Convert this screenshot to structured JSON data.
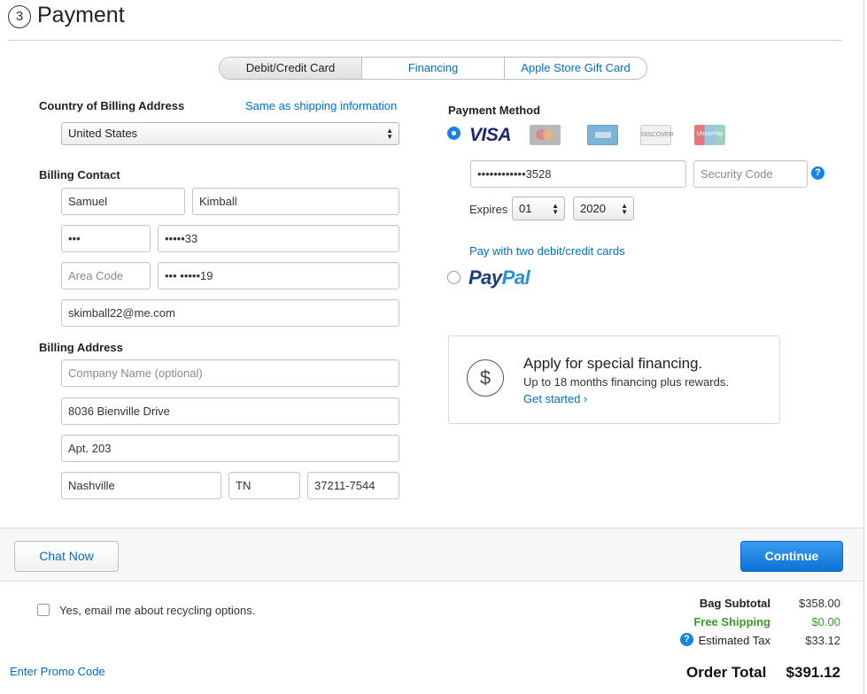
{
  "header": {
    "step_number": "3",
    "title": "Payment"
  },
  "tabs": [
    {
      "label": "Debit/Credit Card",
      "selected": true
    },
    {
      "label": "Financing",
      "selected": false
    },
    {
      "label": "Apple Store Gift Card",
      "selected": false
    }
  ],
  "billing": {
    "country_label": "Country of Billing Address",
    "same_as_shipping_link": "Same as shipping information",
    "country_value": "United States",
    "contact_label": "Billing Contact",
    "first_name": "Samuel",
    "last_name": "Kimball",
    "phone_prefix": "•••",
    "phone_masked": "•••••33",
    "area_code_placeholder": "Area Code",
    "phone2_masked": "••• •••••19",
    "email": "skimball22@me.com",
    "address_label": "Billing Address",
    "company_placeholder": "Company Name (optional)",
    "street": "8036 Bienville Drive",
    "apt": "Apt. 203",
    "city": "Nashville",
    "state": "TN",
    "zip": "37211-7544"
  },
  "payment": {
    "method_label": "Payment Method",
    "visa_text": "VISA",
    "discover_text": "DISCOVER",
    "unionpay_text": "UnionPay",
    "card_number_masked": "••••••••••••3528",
    "security_code_placeholder": "Security Code",
    "help_glyph": "?",
    "expires_label": "Expires",
    "exp_month": "01",
    "exp_year": "2020",
    "two_cards_link": "Pay with two debit/credit cards",
    "paypal_part1": "Pay",
    "paypal_part2": "Pal",
    "selected_method": "card"
  },
  "financing_promo": {
    "icon_glyph": "$",
    "title": "Apply for special financing.",
    "subtitle": "Up to 18 months financing plus rewards.",
    "link": "Get started ›"
  },
  "actions": {
    "chat": "Chat Now",
    "continue": "Continue"
  },
  "footer": {
    "recycle_checkbox_label": "Yes, email me about recycling options.",
    "recycle_checked": false,
    "promo_link": "Enter Promo Code"
  },
  "summary": {
    "bag_subtotal_label": "Bag Subtotal",
    "bag_subtotal_value": "$358.00",
    "shipping_label": "Free Shipping",
    "shipping_value": "$0.00",
    "tax_label": "Estimated Tax",
    "tax_value": "$33.12",
    "order_total_label": "Order Total",
    "order_total_value": "$391.12"
  },
  "colors": {
    "accent": "#0070c9",
    "shipping_green": "#3a9a2a",
    "button_blue": "#1a82e2"
  }
}
